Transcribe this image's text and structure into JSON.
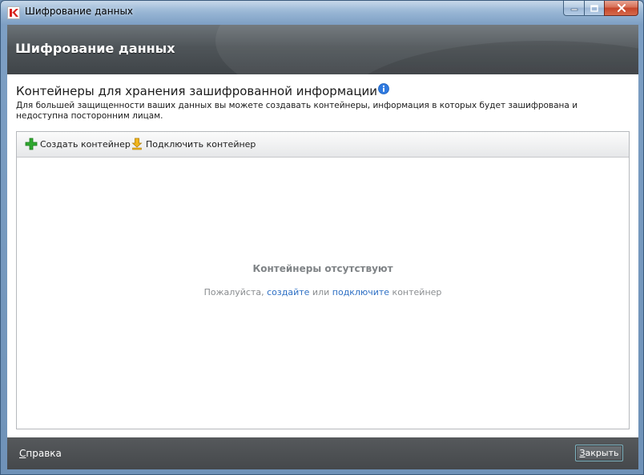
{
  "window": {
    "title": "Шифрование данных"
  },
  "header": {
    "title": "Шифрование данных"
  },
  "section": {
    "title": "Контейнеры для хранения зашифрованной информации",
    "description": "Для большей защищенности ваших данных вы можете создавать контейнеры, информация в которых будет зашифрована и недоступна посторонним лицам."
  },
  "toolbar": {
    "create_label": "Создать контейнер",
    "connect_label": "Подключить контейнер"
  },
  "empty_state": {
    "title": "Контейнеры отсутствуют",
    "hint_prefix": "Пожалуйста, ",
    "hint_link_create": "создайте",
    "hint_middle": " или ",
    "hint_link_connect": "подключите",
    "hint_suffix": " контейнер"
  },
  "footer": {
    "help_first_letter": "С",
    "help_rest": "правка",
    "close_first_letter": "З",
    "close_rest": "акрыть"
  },
  "colors": {
    "link": "#2d6fc4",
    "logo_red": "#d8231c",
    "info_blue": "#2f7ae0",
    "create_green": "#2fa82f",
    "connect_yellow": "#f1b51c"
  },
  "icons": {
    "logo": "kaspersky-logo-icon",
    "info": "info-icon",
    "create": "green-plus-icon",
    "connect": "yellow-down-arrow-icon",
    "minimize": "minimize-icon",
    "maximize": "maximize-icon",
    "close": "close-icon"
  }
}
